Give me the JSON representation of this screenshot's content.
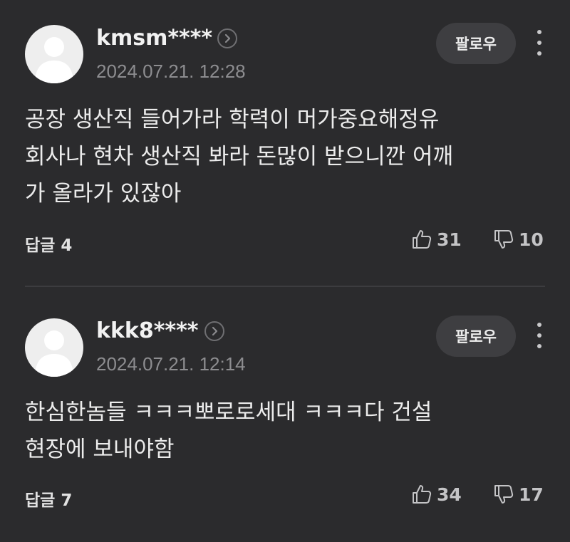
{
  "comments": [
    {
      "username": "kmsm****",
      "date": "2024.07.21. 12:28",
      "follow_label": "팔로우",
      "text": "공장 생산직 들어가라 학력이 머가중요해정유\n회사나 현차 생산직 봐라 돈많이 받으니깐 어깨\n가 올라가 있잖아",
      "reply_label": "답글 4",
      "likes": "31",
      "dislikes": "10"
    },
    {
      "username": "kkk8****",
      "date": "2024.07.21. 12:14",
      "follow_label": "팔로우",
      "text": "한심한놈들 ㅋㅋㅋ뽀로로세대 ㅋㅋㅋ다 건설\n현장에 보내야함",
      "reply_label": "답글 7",
      "likes": "34",
      "dislikes": "17"
    }
  ],
  "icons": {
    "avatar": "default-avatar-icon",
    "profile_link": "chevron-right-icon",
    "more": "more-vertical-icon",
    "like": "thumbs-up-icon",
    "dislike": "thumbs-down-icon"
  },
  "colors": {
    "background": "#2b2b2d",
    "button": "#3e3e41",
    "text": "#ececec",
    "muted": "#8d8d90"
  }
}
